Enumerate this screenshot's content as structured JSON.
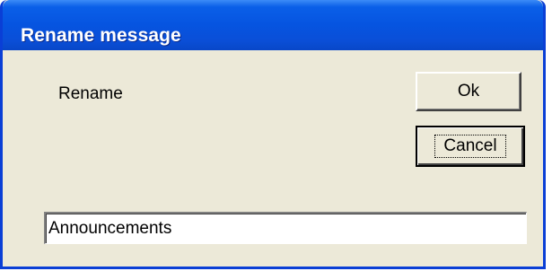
{
  "dialog": {
    "title": "Rename message",
    "label": "Rename",
    "ok_label": "Ok",
    "cancel_label": "Cancel",
    "name_value": "Announcements"
  },
  "colors": {
    "titlebar": "#0654e0",
    "dialog_background": "#ece9d8",
    "title_text": "#ffffff"
  }
}
